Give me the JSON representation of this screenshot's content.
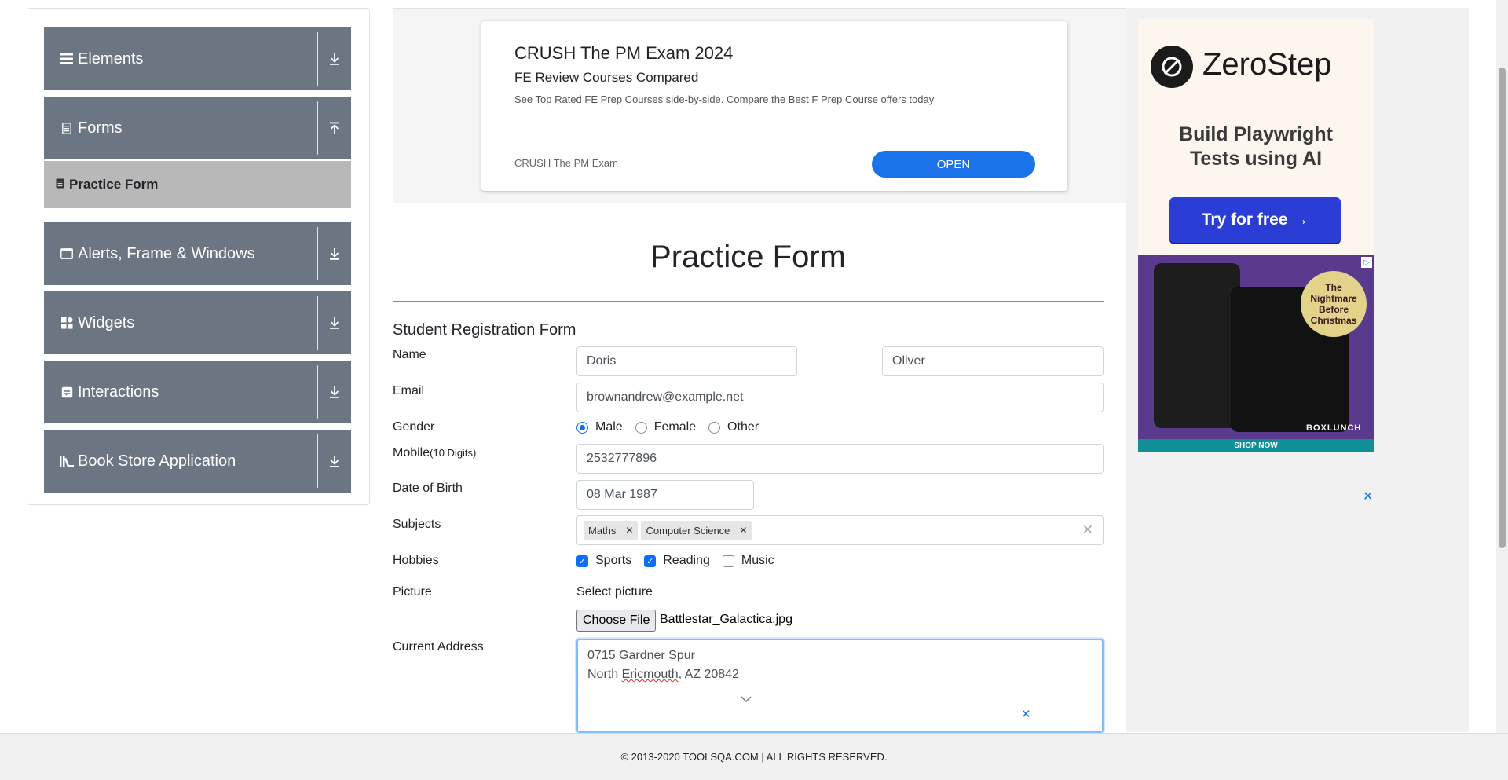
{
  "sidebar": {
    "groups": [
      {
        "label": "Elements",
        "icon": "hamburger-icon",
        "arrow": "download-icon"
      },
      {
        "label": "Forms",
        "icon": "document-icon",
        "arrow": "upload-icon"
      },
      {
        "label": "Alerts, Frame & Windows",
        "icon": "window-icon",
        "arrow": "download-icon"
      },
      {
        "label": "Widgets",
        "icon": "widgets-icon",
        "arrow": "download-icon"
      },
      {
        "label": "Interactions",
        "icon": "interactions-icon",
        "arrow": "download-icon"
      },
      {
        "label": "Book Store Application",
        "icon": "books-icon",
        "arrow": "download-icon"
      }
    ],
    "active_item": "Practice Form"
  },
  "ad_banner": {
    "title": "CRUSH The PM Exam 2024",
    "subtitle": "FE Review Courses Compared",
    "description": "See Top Rated FE Prep Courses side-by-side. Compare the Best F Prep Course offers today",
    "brand": "CRUSH The PM Exam",
    "button": "OPEN"
  },
  "right_ads": {
    "zerostep_name": "ZeroStep",
    "zerostep_tagline_1": "Build Playwright",
    "zerostep_tagline_2": "Tests using AI",
    "zerostep_button": "Try for free →",
    "disney_badge": "The Nightmare Before Christmas",
    "disney_brand": "BOXLUNCH",
    "disney_cta": "SHOP NOW"
  },
  "form": {
    "page_title": "Practice Form",
    "subtitle": "Student Registration Form",
    "labels": {
      "name": "Name",
      "email": "Email",
      "gender": "Gender",
      "mobile": "Mobile",
      "mobile_hint": "(10 Digits)",
      "dob": "Date of Birth",
      "subjects": "Subjects",
      "hobbies": "Hobbies",
      "picture": "Picture",
      "address": "Current Address"
    },
    "first_name": "Doris",
    "last_name": "Oliver",
    "email": "brownandrew@example.net",
    "gender_options": [
      "Male",
      "Female",
      "Other"
    ],
    "gender_selected": "Male",
    "mobile": "2532777896",
    "dob": "08 Mar 1987",
    "subjects": [
      "Maths",
      "Computer Science"
    ],
    "hobbies": [
      {
        "label": "Sports",
        "checked": true
      },
      {
        "label": "Reading",
        "checked": true
      },
      {
        "label": "Music",
        "checked": false
      }
    ],
    "picture_label": "Select picture",
    "choose_file": "Choose File",
    "file_name": "Battlestar_Galactica.jpg",
    "address_line1": "0715 Gardner Spur",
    "address_line2_a": "North ",
    "address_line2_b": "Ericmouth",
    "address_line2_c": ", AZ 20842"
  },
  "footer": {
    "text": "© 2013-2020 TOOLSQA.COM | ALL RIGHTS RESERVED."
  }
}
